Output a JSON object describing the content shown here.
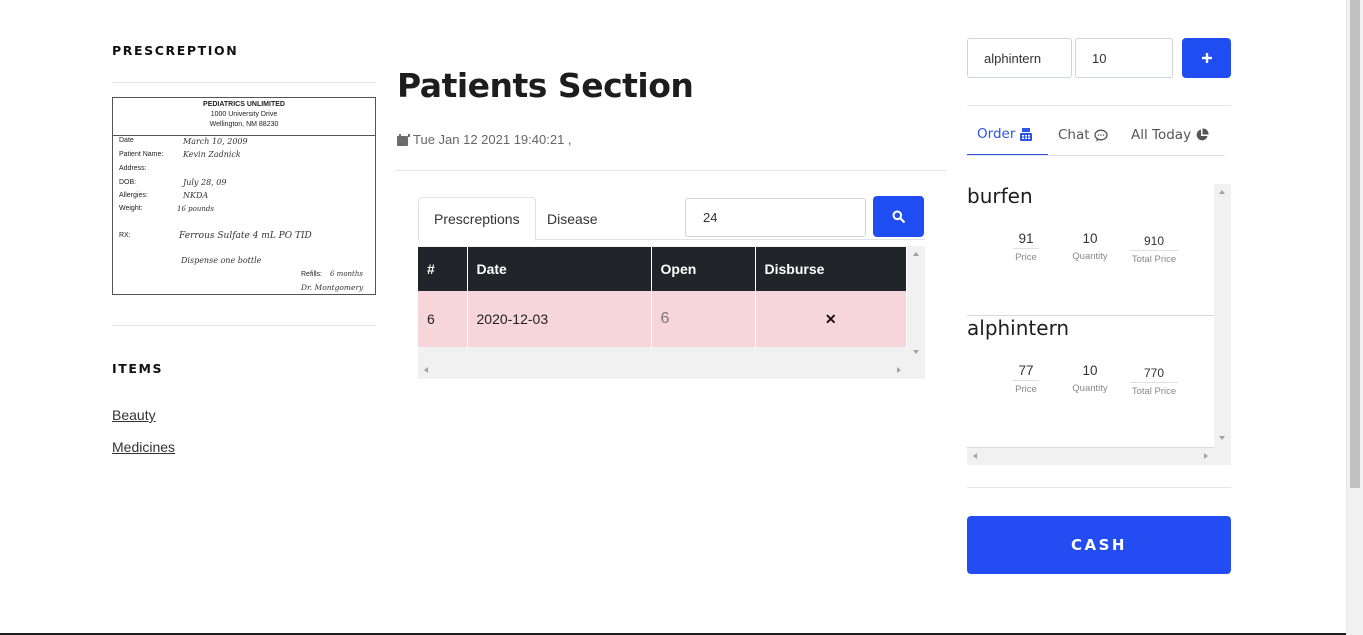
{
  "left": {
    "prescription_title": "PRESCREPTION",
    "rx": {
      "practice_name": "PEDIATRICS UNLIMITED",
      "address_line1": "1000 University Drive",
      "address_line2": "Wellington, NM 88230",
      "date_label": "Date",
      "date_value": "March 10, 2009",
      "patient_label": "Patient Name:",
      "patient_value": "Kevin Zadnick",
      "address_label": "Address:",
      "dob_label": "DOB:",
      "dob_value": "July 28, 09",
      "allergies_label": "Allergies:",
      "allergies_value": "NKDA",
      "weight_label": "Weight:",
      "weight_value": "16 pounds",
      "rx_label": "RX:",
      "rx_value": "Ferrous Sulfate 4 mL PO TID",
      "dispense_value": "Dispense one bottle",
      "refills_label": "Refills:",
      "refills_value": "6 months",
      "doctor_value": "Dr. Montgomery"
    },
    "items_title": "ITEMS",
    "categories": [
      "Beauty",
      "Medicines"
    ]
  },
  "main": {
    "title": "Patients Section",
    "datetime": "Tue Jan 12 2021 19:40:21 ,",
    "tabs": [
      "Prescreptions",
      "Disease"
    ],
    "search_value": "24",
    "table": {
      "headers": [
        "#",
        "Date",
        "Open",
        "Disburse"
      ],
      "rows": [
        {
          "id": "6",
          "date": "2020-12-03",
          "open": "6",
          "disburse": "✕"
        }
      ]
    }
  },
  "right": {
    "item_input": "alphintern",
    "qty_input": "10",
    "tabs": [
      {
        "label": "Order",
        "icon": "cash-register-icon"
      },
      {
        "label": "Chat",
        "icon": "chat-icon"
      },
      {
        "label": "All Today",
        "icon": "pie-chart-icon"
      }
    ],
    "orders": [
      {
        "name": "burfen",
        "price": "91",
        "quantity": "10",
        "total": "910"
      },
      {
        "name": "alphintern",
        "price": "77",
        "quantity": "10",
        "total": "770"
      }
    ],
    "labels": {
      "price": "Price",
      "quantity": "Quantity",
      "total": "Total Price"
    },
    "cash_label": "CASH"
  },
  "colors": {
    "accent": "#1f4df2",
    "table_header": "#212529",
    "row_highlight": "#f6d6da"
  }
}
